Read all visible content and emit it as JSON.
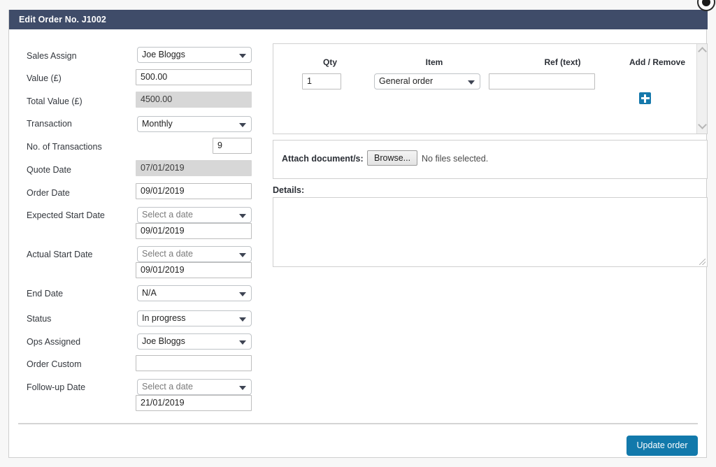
{
  "modal": {
    "title": "Edit Order No. J1002"
  },
  "form": {
    "fields": [
      {
        "label": "Sales Assign",
        "value": "Joe Bloggs",
        "type": "select"
      },
      {
        "label": "Value (£)",
        "value": "500.00",
        "type": "text"
      },
      {
        "label": "Total Value (£)",
        "value": "4500.00",
        "type": "disabled"
      },
      {
        "label": "Transaction",
        "value": "Monthly",
        "type": "select"
      },
      {
        "label": "No. of Transactions",
        "value": "9",
        "type": "text-narrow"
      },
      {
        "label": "Quote Date",
        "value": "07/01/2019",
        "type": "disabled"
      },
      {
        "label": "Order Date",
        "value": "09/01/2019",
        "type": "text"
      },
      {
        "label": "Expected Start Date",
        "value": "Select a date",
        "sub_value": "09/01/2019",
        "type": "date-pair"
      },
      {
        "label": "Actual Start Date",
        "value": "Select a date",
        "sub_value": "09/01/2019",
        "type": "date-pair"
      },
      {
        "label": "End Date",
        "value": "N/A",
        "type": "select"
      },
      {
        "label": "Status",
        "value": "In progress",
        "type": "select"
      },
      {
        "label": "Ops Assigned",
        "value": "Joe Bloggs",
        "type": "select"
      },
      {
        "label": "Order Custom",
        "value": "",
        "type": "text"
      },
      {
        "label": "Follow-up Date",
        "value": "Select a date",
        "sub_value": "21/01/2019",
        "type": "date-pair"
      }
    ]
  },
  "items_panel": {
    "headers": [
      "Qty",
      "Item",
      "Ref (text)",
      "Add / Remove"
    ],
    "row": {
      "qty": "1",
      "item": "General order",
      "ref": "",
      "add_icon": "plus-icon"
    }
  },
  "attach": {
    "label": "Attach document/s:",
    "browse_label": "Browse...",
    "status": "No files selected."
  },
  "details": {
    "label": "Details:",
    "value": ""
  },
  "footer": {
    "update_label": "Update order"
  },
  "colors": {
    "header_bar": "#3f4c69",
    "primary_button": "#1279ab",
    "add_icon": "#1679ac",
    "disabled_field": "#d7d7d7"
  }
}
